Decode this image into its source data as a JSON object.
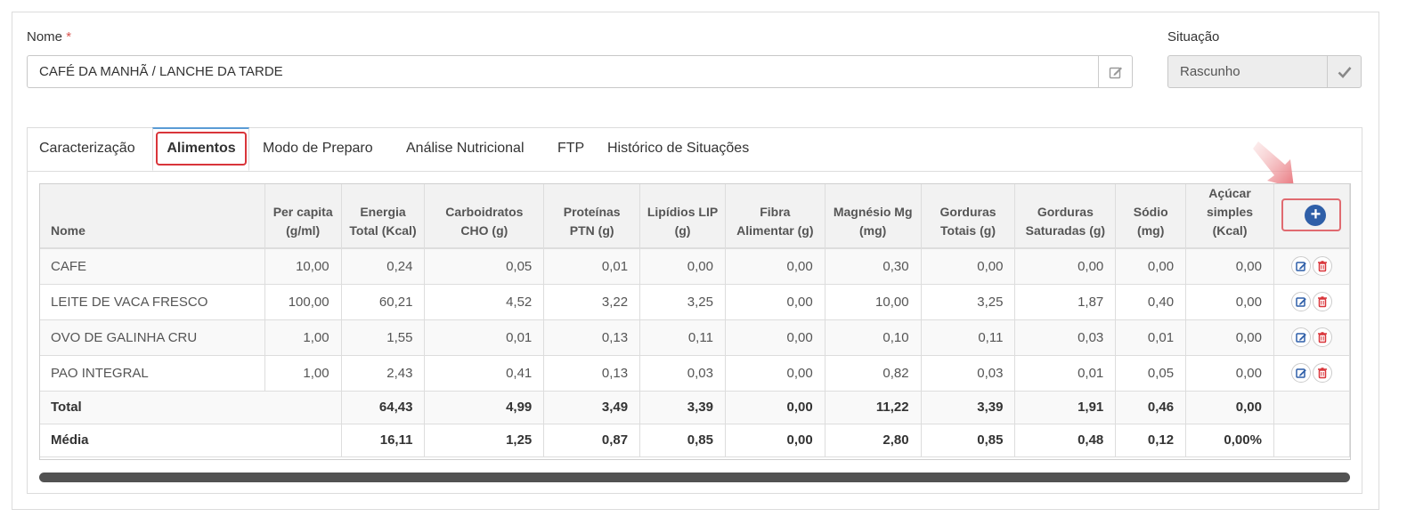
{
  "form": {
    "name_label": "Nome",
    "required_mark": "*",
    "name_value": "CAFÉ DA MANHÃ / LANCHE DA TARDE",
    "situacao_label": "Situação",
    "situacao_value": "Rascunho"
  },
  "tabs": [
    {
      "label": "Caracterização",
      "active": false
    },
    {
      "label": "Alimentos",
      "active": true
    },
    {
      "label": "Modo de Preparo",
      "active": false
    },
    {
      "label": "Análise Nutricional",
      "active": false
    },
    {
      "label": "FTP",
      "active": false
    },
    {
      "label": "Histórico de Situações",
      "active": false
    }
  ],
  "table": {
    "headers": [
      "Nome",
      "Per capita (g/ml)",
      "Energia Total (Kcal)",
      "Carboidratos CHO (g)",
      "Proteínas PTN (g)",
      "Lipídios LIP (g)",
      "Fibra Alimentar (g)",
      "Magnésio Mg (mg)",
      "Gorduras Totais (g)",
      "Gorduras Saturadas (g)",
      "Sódio (mg)",
      "Açúcar simples (Kcal)"
    ],
    "rows": [
      [
        "CAFE",
        "10,00",
        "0,24",
        "0,05",
        "0,01",
        "0,00",
        "0,00",
        "0,30",
        "0,00",
        "0,00",
        "0,00",
        "0,00"
      ],
      [
        "LEITE DE VACA FRESCO",
        "100,00",
        "60,21",
        "4,52",
        "3,22",
        "3,25",
        "0,00",
        "10,00",
        "3,25",
        "1,87",
        "0,40",
        "0,00"
      ],
      [
        "OVO DE GALINHA CRU",
        "1,00",
        "1,55",
        "0,01",
        "0,13",
        "0,11",
        "0,00",
        "0,10",
        "0,11",
        "0,03",
        "0,01",
        "0,00"
      ],
      [
        "PAO INTEGRAL",
        "1,00",
        "2,43",
        "0,41",
        "0,13",
        "0,03",
        "0,00",
        "0,82",
        "0,03",
        "0,01",
        "0,05",
        "0,00"
      ]
    ],
    "total": {
      "label": "Total",
      "values": [
        "64,43",
        "4,99",
        "3,49",
        "3,39",
        "0,00",
        "11,22",
        "3,39",
        "1,91",
        "0,46",
        "0,00"
      ]
    },
    "media": {
      "label": "Média",
      "values": [
        "16,11",
        "1,25",
        "0,87",
        "0,85",
        "0,00",
        "2,80",
        "0,85",
        "0,48",
        "0,12",
        "0,00%"
      ]
    }
  },
  "icons": {
    "name_addon": "edit-icon",
    "situacao_addon": "check-icon",
    "add": "plus-circle-icon",
    "row_edit": "edit-icon",
    "row_delete": "trash-icon"
  },
  "colors": {
    "highlight": "#d9353a",
    "add_button": "#2f5fa8",
    "edit_icon": "#2f5fa8",
    "delete_icon": "#d9353a",
    "tab_active_top": "#5a9bd5"
  }
}
